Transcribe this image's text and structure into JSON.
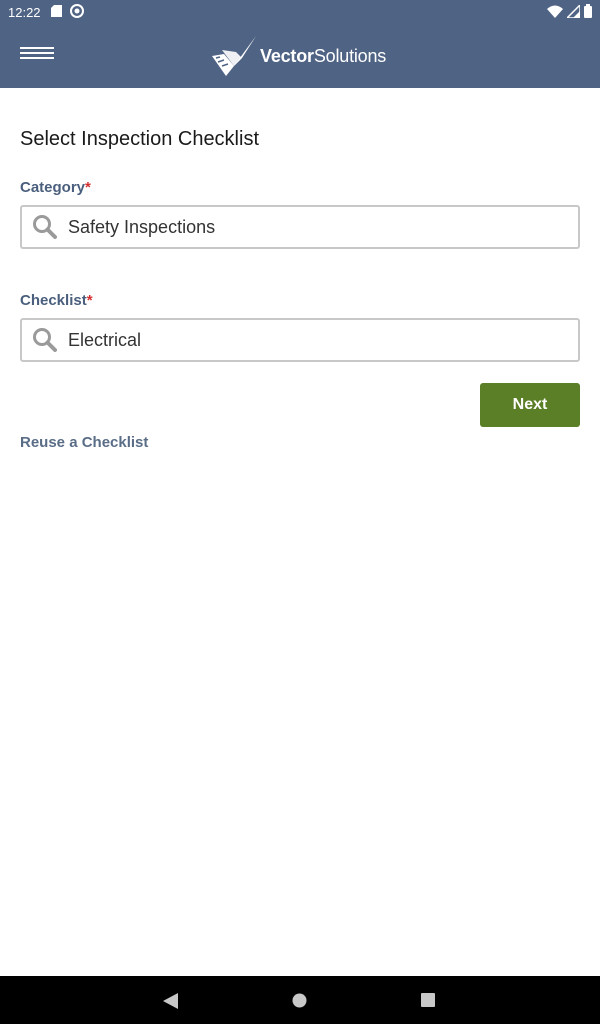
{
  "status_bar": {
    "time": "12:22"
  },
  "app_bar": {
    "logo_bold": "Vector",
    "logo_light": "Solutions"
  },
  "page": {
    "title": "Select Inspection Checklist"
  },
  "category": {
    "label": "Category",
    "required_mark": "*",
    "value": "Safety Inspections"
  },
  "checklist": {
    "label": "Checklist",
    "required_mark": "*",
    "value": "Electrical"
  },
  "actions": {
    "next_label": "Next",
    "reuse_label": "Reuse a Checklist"
  },
  "colors": {
    "header": "#4f6384",
    "accent": "#5b7f26",
    "label": "#4a5f7d",
    "required": "#d32f2f"
  },
  "icons": [
    "sd-card-icon",
    "sync-icon",
    "wifi-icon",
    "signal-icon",
    "battery-icon",
    "menu-icon",
    "search-icon",
    "back-icon",
    "home-icon",
    "recents-icon"
  ]
}
